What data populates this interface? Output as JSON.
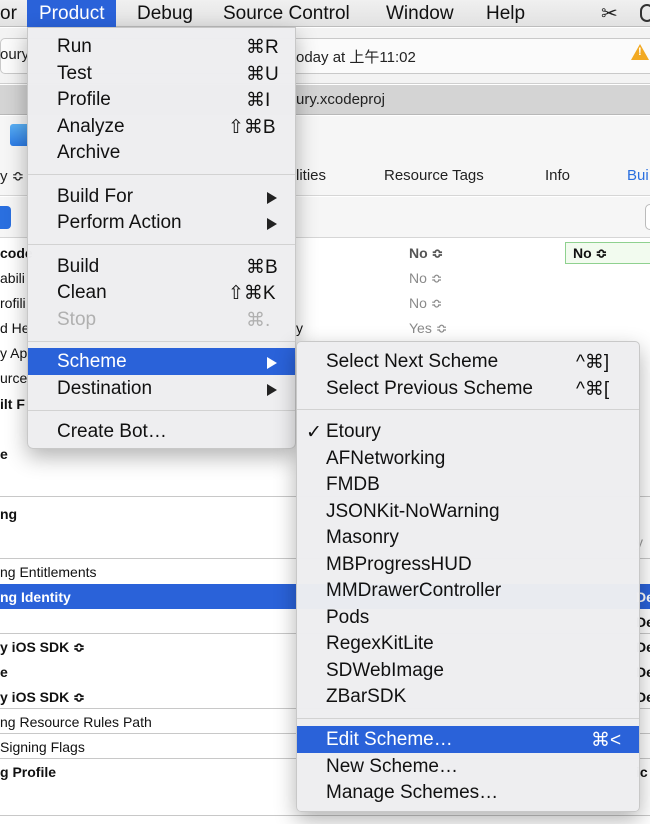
{
  "menubar": {
    "items": [
      "or",
      "Product",
      "Debug",
      "Source Control",
      "Window",
      "Help"
    ]
  },
  "window": {
    "status_left": "oury",
    "status_right": "oday at 上午11:02",
    "path": "ury.xcodeproj",
    "tabs": [
      "lities",
      "Resource Tags",
      "Info",
      "Bui"
    ],
    "filter_left": "y ≎",
    "settings": [
      {
        "label": "code",
        "value": "No ≎"
      },
      {
        "label": "abili",
        "value": "No ≎"
      },
      {
        "label": "rofili",
        "value": "No ≎"
      },
      {
        "label": "d He",
        "value": "Yes ≎"
      },
      {
        "label": "y Ap",
        "value": ""
      },
      {
        "label": "urce",
        "value": ""
      },
      {
        "label": "ilt F",
        "value": ""
      },
      {
        "label": "e",
        "value": ""
      }
    ],
    "setting_mid_frag": "y",
    "resolved_value": "No ≎",
    "signing_header": "ng",
    "signing_rows": [
      "ng Entitlements",
      "ng Identity",
      "y iOS SDK ≎",
      "e",
      "y iOS SDK ≎",
      "ng Resource Rules Path",
      " Signing Flags",
      "g Profile"
    ],
    "right_frags": [
      "De",
      "De",
      "De",
      "De",
      "De",
      "ic"
    ],
    "right_grey": "y"
  },
  "product_menu": {
    "groups": [
      [
        {
          "label": "Run",
          "shortcut": "⌘R"
        },
        {
          "label": "Test",
          "shortcut": "⌘U"
        },
        {
          "label": "Profile",
          "shortcut": "⌘I"
        },
        {
          "label": "Analyze",
          "shortcut": "⇧⌘B"
        },
        {
          "label": "Archive",
          "shortcut": ""
        }
      ],
      [
        {
          "label": "Build For",
          "shortcut": ""
        },
        {
          "label": "Perform Action",
          "shortcut": ""
        }
      ],
      [
        {
          "label": "Build",
          "shortcut": "⌘B"
        },
        {
          "label": "Clean",
          "shortcut": "⇧⌘K"
        },
        {
          "label": "Stop",
          "shortcut": "⌘."
        }
      ],
      [
        {
          "label": "Scheme",
          "shortcut": ""
        },
        {
          "label": "Destination",
          "shortcut": ""
        }
      ],
      [
        {
          "label": "Create Bot…",
          "shortcut": ""
        }
      ]
    ]
  },
  "scheme_menu": {
    "nav": [
      {
        "label": "Select Next Scheme",
        "shortcut": "^⌘]"
      },
      {
        "label": "Select Previous Scheme",
        "shortcut": "^⌘["
      }
    ],
    "checkmark": "✓",
    "schemes": [
      "Etoury",
      "AFNetworking",
      "FMDB",
      "JSONKit-NoWarning",
      "Masonry",
      "MBProgressHUD",
      "MMDrawerController",
      "Pods",
      "RegexKitLite",
      "SDWebImage",
      "ZBarSDK"
    ],
    "actions": [
      {
        "label": "Edit Scheme…",
        "shortcut": "⌘<"
      },
      {
        "label": "New Scheme…",
        "shortcut": ""
      },
      {
        "label": "Manage Schemes…",
        "shortcut": ""
      }
    ]
  },
  "colors": {
    "highlight": "#2a62d9",
    "warning": "#f2a922",
    "link": "#2a6fdf"
  }
}
